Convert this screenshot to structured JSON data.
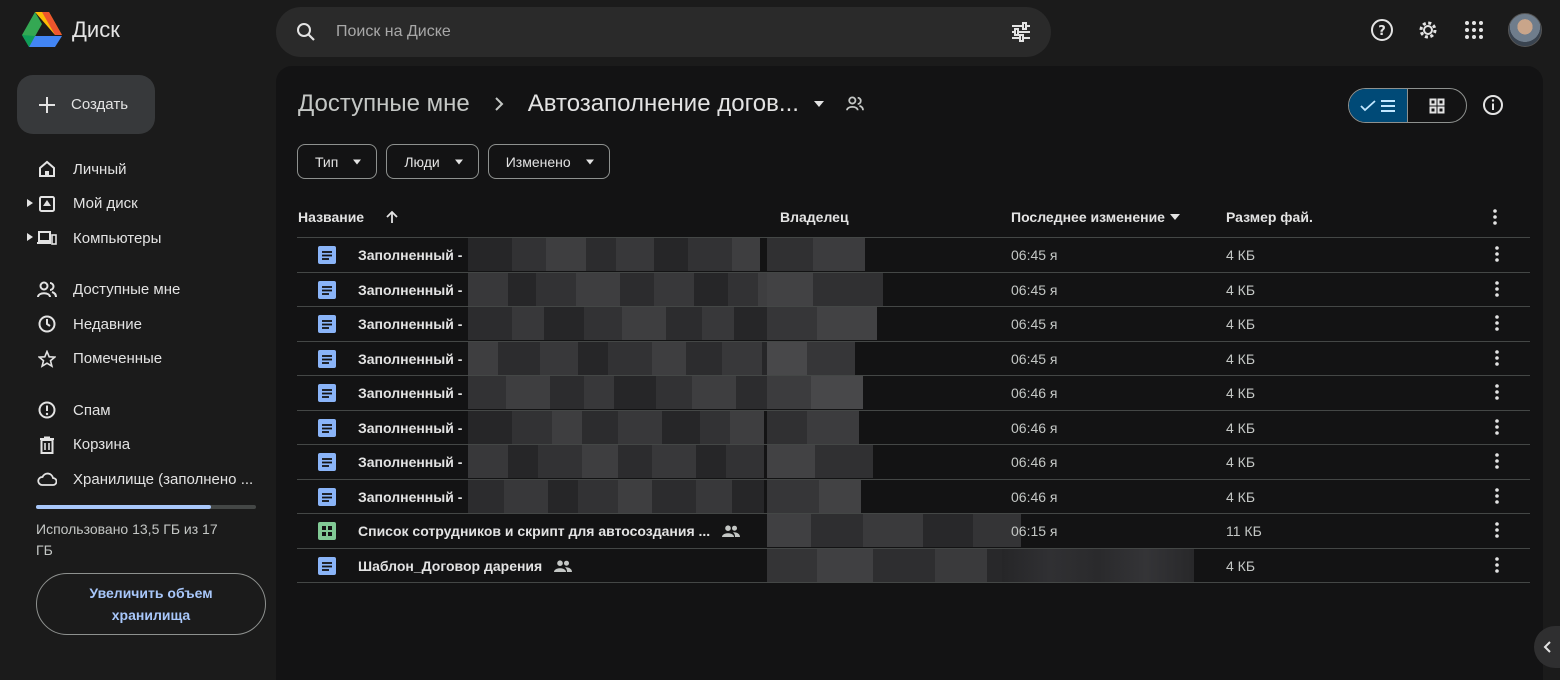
{
  "app": {
    "title": "Диск"
  },
  "search": {
    "placeholder": "Поиск на Диске"
  },
  "sidebar": {
    "create_label": "Создать",
    "items": [
      {
        "label": "Личный",
        "icon": "home-icon"
      },
      {
        "label": "Мой диск",
        "icon": "drive-icon"
      },
      {
        "label": "Компьютеры",
        "icon": "computers-icon"
      },
      {
        "label": "Доступные мне",
        "icon": "shared-icon"
      },
      {
        "label": "Недавние",
        "icon": "clock-icon"
      },
      {
        "label": "Помеченные",
        "icon": "star-icon"
      },
      {
        "label": "Спам",
        "icon": "spam-icon"
      },
      {
        "label": "Корзина",
        "icon": "trash-icon"
      },
      {
        "label": "Хранилище (заполнено ...",
        "icon": "cloud-icon"
      }
    ],
    "storage": {
      "text": "Использовано 13,5 ГБ из 17 ГБ",
      "used_gb": 13.5,
      "total_gb": 17
    },
    "upgrade_label": "Увеличить объем хранилища"
  },
  "main": {
    "breadcrumb": {
      "parent": "Доступные мне",
      "current": "Автозаполнение догов..."
    },
    "filters": [
      "Тип",
      "Люди",
      "Изменено"
    ],
    "columns": {
      "name": "Название",
      "owner": "Владелец",
      "modified": "Последнее изменение",
      "size": "Размер фай."
    },
    "rows": [
      {
        "type": "doc",
        "name": "Заполненный -",
        "modified": "06:45 я",
        "size": "4 КБ",
        "shared": false
      },
      {
        "type": "doc",
        "name": "Заполненный -",
        "modified": "06:45 я",
        "size": "4 КБ",
        "shared": false
      },
      {
        "type": "doc",
        "name": "Заполненный -",
        "modified": "06:45 я",
        "size": "4 КБ",
        "shared": false
      },
      {
        "type": "doc",
        "name": "Заполненный -",
        "modified": "06:45 я",
        "size": "4 КБ",
        "shared": false
      },
      {
        "type": "doc",
        "name": "Заполненный -",
        "modified": "06:46 я",
        "size": "4 КБ",
        "shared": false
      },
      {
        "type": "doc",
        "name": "Заполненный -",
        "modified": "06:46 я",
        "size": "4 КБ",
        "shared": false
      },
      {
        "type": "doc",
        "name": "Заполненный -",
        "modified": "06:46 я",
        "size": "4 КБ",
        "shared": false
      },
      {
        "type": "doc",
        "name": "Заполненный -",
        "modified": "06:46 я",
        "size": "4 КБ",
        "shared": false
      },
      {
        "type": "sheet",
        "name": "Список сотрудников и скрипт для автосоздания ...",
        "modified": "06:15 я",
        "size": "11 КБ",
        "shared": true
      },
      {
        "type": "doc",
        "name": "Шаблон_Договор дарения",
        "modified": "",
        "size": "4 КБ",
        "shared": true
      }
    ]
  },
  "colors": {
    "background": "#1b1b1b",
    "panel": "#131314",
    "accent": "#a8c7fa",
    "doc_icon": "#8ab4f8",
    "sheet_icon": "#81c995"
  }
}
